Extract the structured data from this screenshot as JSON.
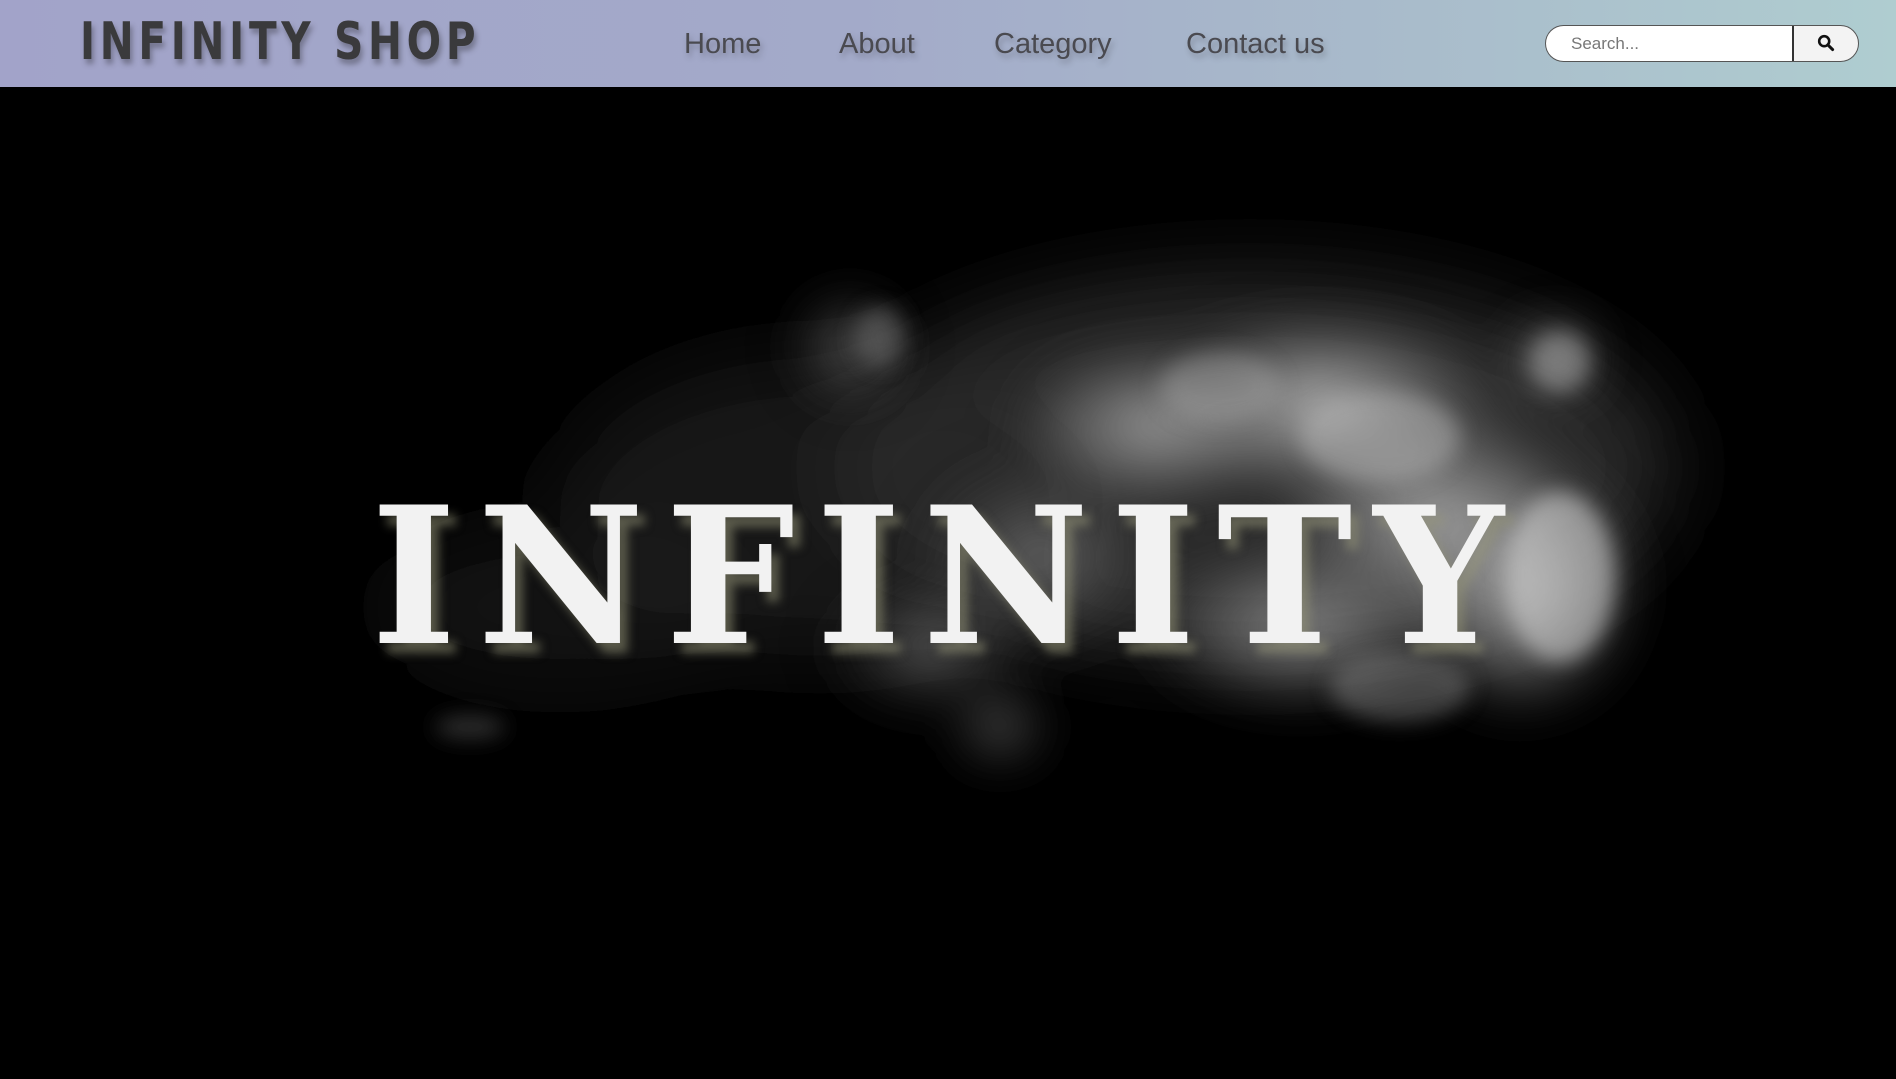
{
  "header": {
    "brand": "INFINITY SHOP",
    "nav": [
      {
        "label": "Home"
      },
      {
        "label": "About"
      },
      {
        "label": "Category"
      },
      {
        "label": "Contact us"
      }
    ],
    "search": {
      "placeholder": "Search...",
      "value": "",
      "button_icon": "search-icon"
    },
    "colors": {
      "gradient_start": "#a2a3c9",
      "gradient_end": "#afcdd0",
      "text": "#3a3a3c"
    }
  },
  "hero": {
    "title": "INFINITY",
    "background": "#000000",
    "decoration": "smoke-cloud"
  }
}
